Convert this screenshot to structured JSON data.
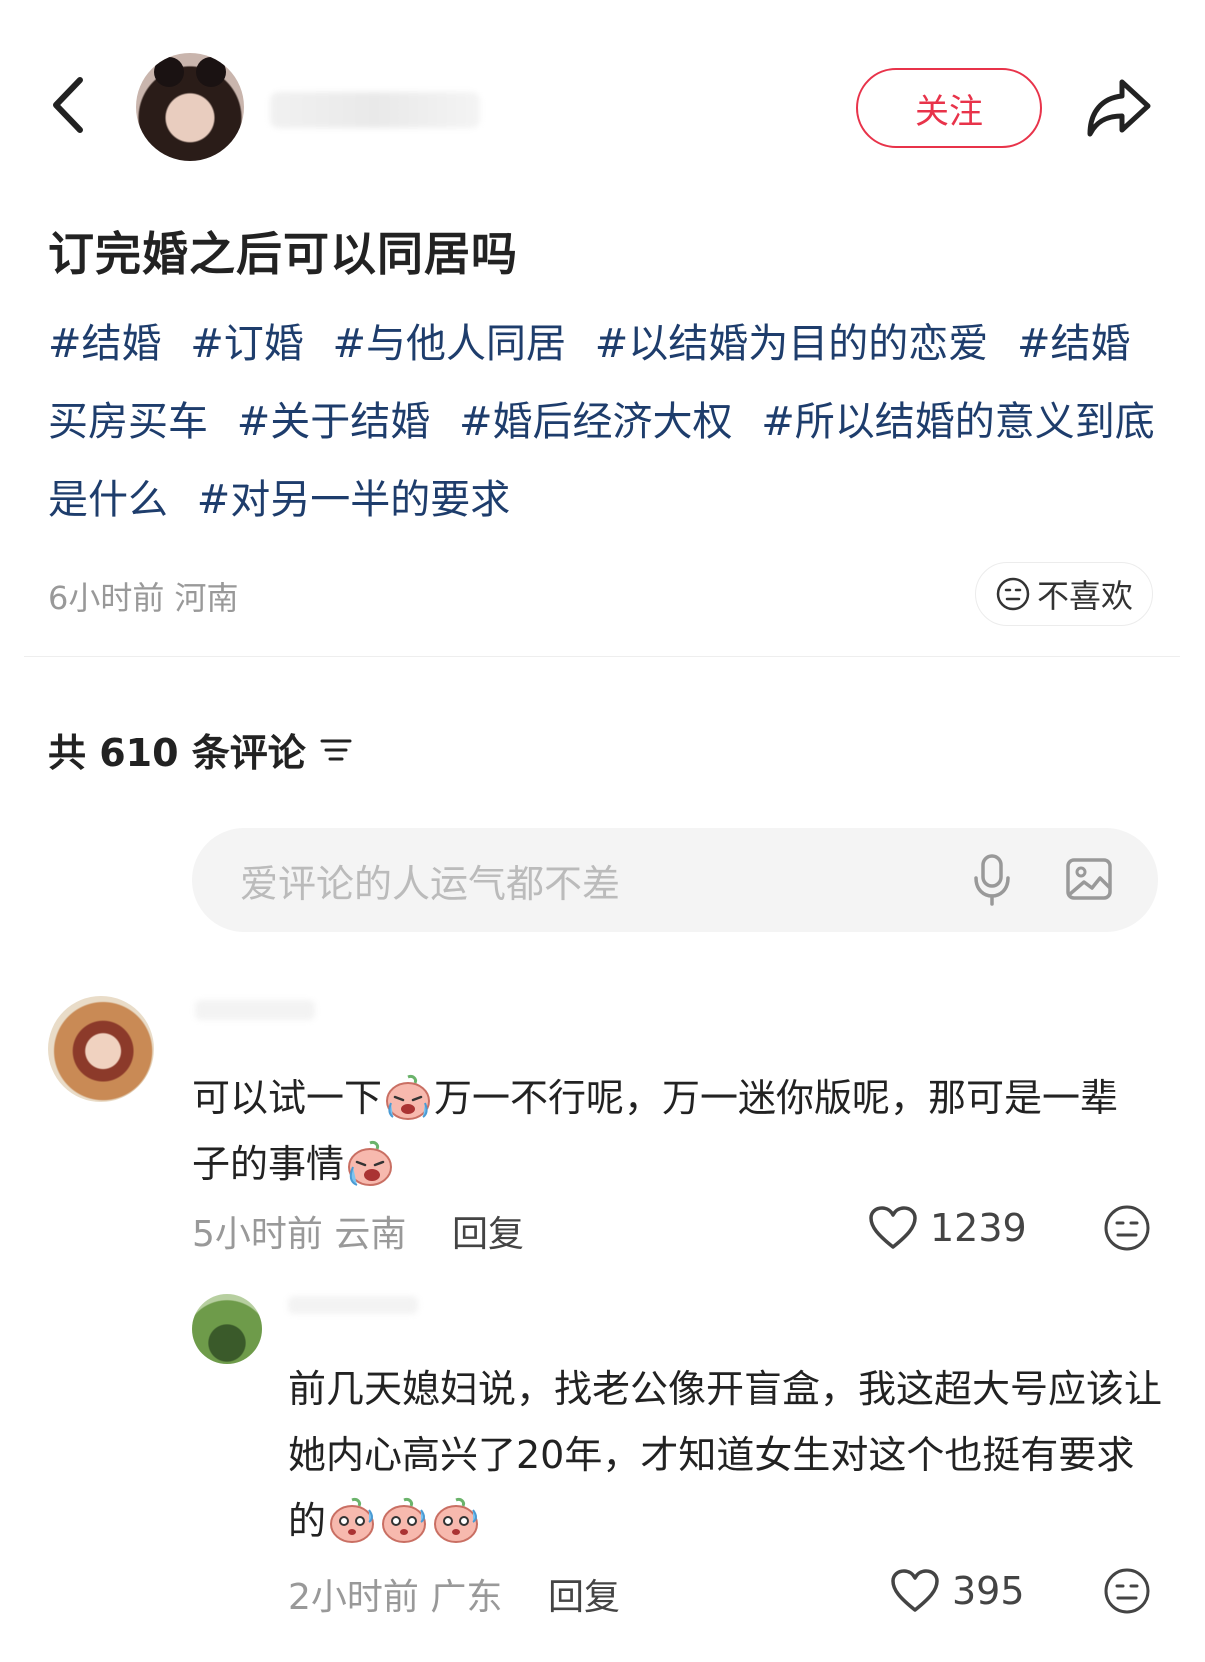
{
  "header": {
    "follow_label": "关注",
    "icons": {
      "back": "back-arrow-icon",
      "share": "share-icon"
    }
  },
  "post": {
    "title": "订完婚之后可以同居吗",
    "tags": [
      "#结婚",
      "#订婚",
      "#与他人同居",
      "#以结婚为目的的恋爱",
      "#结婚买房买车",
      "#关于结婚",
      "#婚后经济大权",
      "#所以结婚的意义到底是什么",
      "#对另一半的要求"
    ],
    "meta": "6小时前 河南",
    "dislike_label": "不喜欢"
  },
  "comments_section": {
    "count_label": "共 610 条评论",
    "input_placeholder": "爱评论的人运气都不差"
  },
  "comments": [
    {
      "text_part1": "可以试一下",
      "text_part2": "万一不行呢，万一迷你版呢，那可是一辈子的事情",
      "meta": "5小时前 云南",
      "reply_label": "回复",
      "likes": "1239"
    },
    {
      "text": "前几天媳妇说，找老公像开盲盒，我这超大号应该让她内心高兴了20年，才知道女生对这个也挺有要求的",
      "meta": "2小时前 广东",
      "reply_label": "回复",
      "likes": "395"
    }
  ],
  "colors": {
    "accent": "#e8334a",
    "tag": "#1e3d6c",
    "muted": "#999999"
  }
}
